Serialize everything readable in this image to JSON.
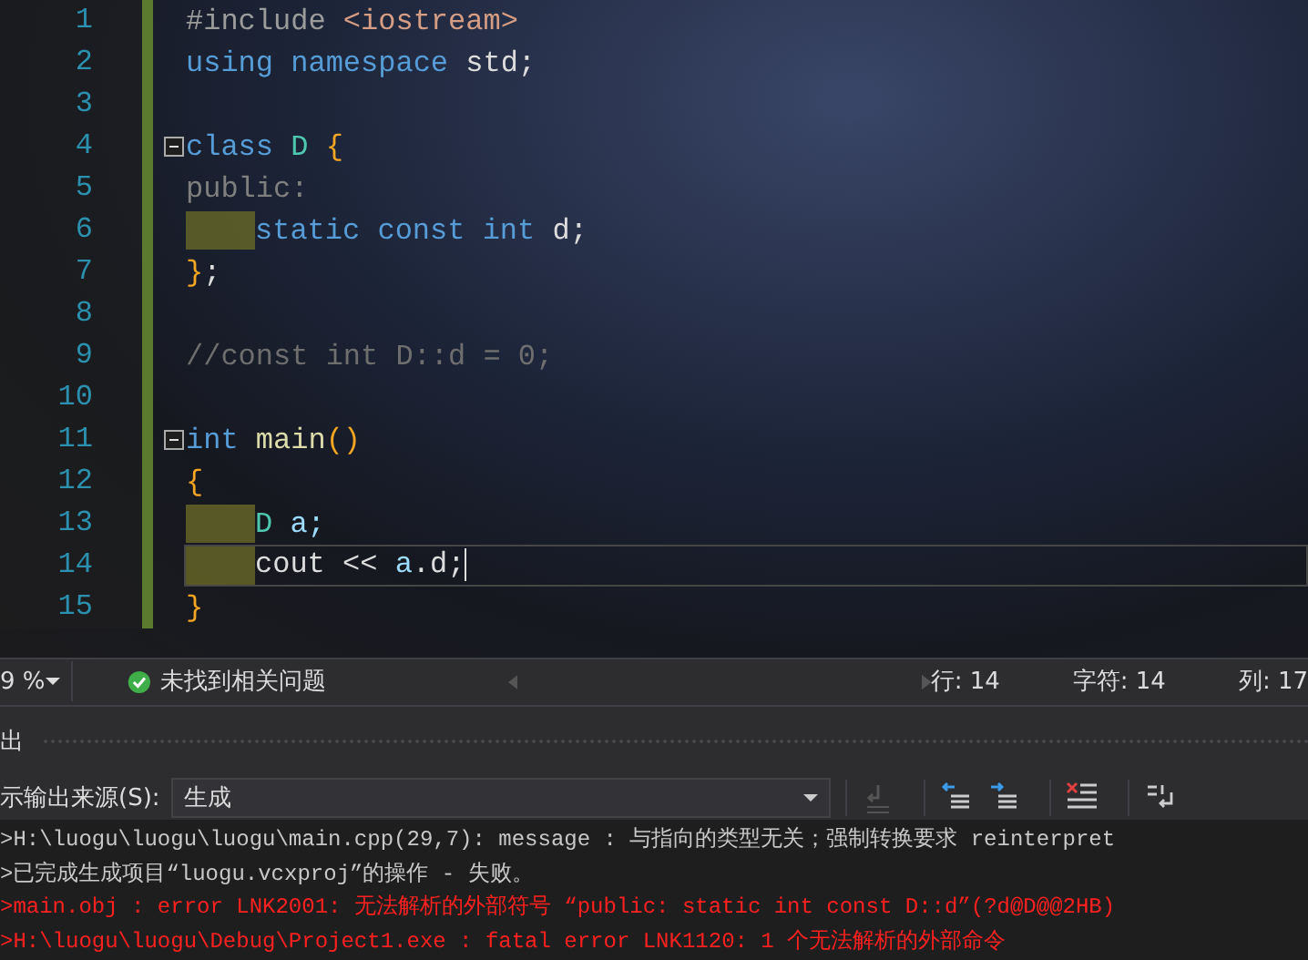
{
  "editor": {
    "lines": [
      {
        "number": "1",
        "tokens": [
          {
            "kind": "preproc",
            "text": "#include "
          },
          {
            "kind": "string",
            "text": "<iostream>"
          }
        ]
      },
      {
        "number": "2",
        "tokens": [
          {
            "kind": "keyword",
            "text": "using namespace "
          },
          {
            "kind": "plain",
            "text": "std;"
          }
        ]
      },
      {
        "number": "3"
      },
      {
        "number": "4",
        "fold_expanded": true,
        "tokens": [
          {
            "kind": "keyword",
            "text": "class "
          },
          {
            "kind": "type",
            "text": "D "
          },
          {
            "kind": "bracket",
            "text": "{"
          }
        ]
      },
      {
        "number": "5",
        "tokens": [
          {
            "kind": "muted",
            "text": "public:"
          }
        ]
      },
      {
        "number": "6",
        "indent_highlight": true,
        "tokens": [
          {
            "kind": "keyword",
            "text": "static const int "
          },
          {
            "kind": "plain",
            "text": "d;"
          }
        ]
      },
      {
        "number": "7",
        "tokens": [
          {
            "kind": "bracket",
            "text": "}"
          },
          {
            "kind": "plain",
            "text": ";"
          }
        ]
      },
      {
        "number": "8"
      },
      {
        "number": "9",
        "tokens": [
          {
            "kind": "comment",
            "text": "//const int D::d = 0;"
          }
        ]
      },
      {
        "number": "10"
      },
      {
        "number": "11",
        "fold_expanded": true,
        "tokens": [
          {
            "kind": "keyword",
            "text": "int "
          },
          {
            "kind": "function",
            "text": "main"
          },
          {
            "kind": "bracket",
            "text": "()"
          }
        ]
      },
      {
        "number": "12",
        "tokens": [
          {
            "kind": "bracket",
            "text": "{"
          }
        ]
      },
      {
        "number": "13",
        "indent_highlight": true,
        "tokens": [
          {
            "kind": "type",
            "text": "D "
          },
          {
            "kind": "variable",
            "text": "a;"
          }
        ]
      },
      {
        "number": "14",
        "indent_highlight": true,
        "current": true,
        "tokens": [
          {
            "kind": "plain",
            "text": "cout << "
          },
          {
            "kind": "variable",
            "text": "a"
          },
          {
            "kind": "plain",
            "text": ".d;"
          }
        ]
      },
      {
        "number": "15",
        "tokens": [
          {
            "kind": "bracket",
            "text": "}"
          }
        ]
      }
    ]
  },
  "status_bar": {
    "zoom": "9 %",
    "issues": "未找到相关问题",
    "line": "行: 14",
    "char": "字符: 14",
    "column": "列: 17"
  },
  "output": {
    "title": "出",
    "source_label": "示输出来源(S):",
    "source": "生成",
    "lines": [
      {
        "kind": "message",
        "text": ">H:\\luogu\\luogu\\luogu\\main.cpp(29,7): message : 与指向的类型无关；强制转换要求 reinterpret"
      },
      {
        "kind": "message",
        "text": ">已完成生成项目“luogu.vcxproj”的操作 - 失败。"
      },
      {
        "kind": "error",
        "text": ">main.obj : error LNK2001: 无法解析的外部符号 “public: static int const D::d”(?d@D@@2HB)"
      },
      {
        "kind": "error",
        "text": ">H:\\luogu\\luogu\\Debug\\Project1.exe : fatal error LNK1120: 1 个无法解析的外部命令"
      }
    ]
  }
}
